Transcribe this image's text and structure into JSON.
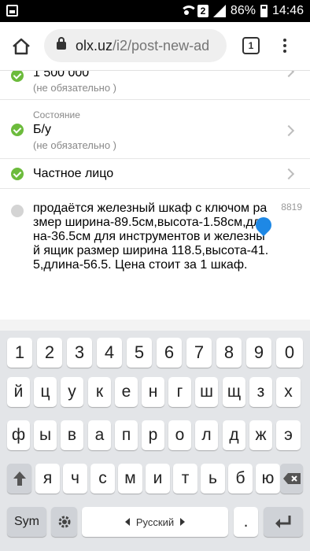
{
  "status_bar": {
    "battery": "86%",
    "time": "14:46",
    "sim": "2"
  },
  "browser": {
    "url_host": "olx.uz",
    "url_path": "/i2/post-new-ad",
    "tab_count": "1"
  },
  "form": {
    "price": {
      "value": "1 500 000",
      "hint": "(не обязательно )"
    },
    "condition": {
      "label": "Состояние",
      "value": "Б/у",
      "hint": "(не обязательно )"
    },
    "seller_type": {
      "value": "Частное лицо"
    },
    "description": {
      "text": "продаётся  железный шкаф с ключом размер ширина-89.5см,высота-1.58см,длина-36.5см для инструментов и железный ящик размер ширина 118.5,высота-41.5,длина-56.5. Цена стоит за 1 шкаф.",
      "char_counter": "8819"
    }
  },
  "keyboard": {
    "row_numbers": [
      "1",
      "2",
      "3",
      "4",
      "5",
      "6",
      "7",
      "8",
      "9",
      "0"
    ],
    "row1": [
      "й",
      "ц",
      "у",
      "к",
      "е",
      "н",
      "г",
      "ш",
      "щ",
      "з",
      "х"
    ],
    "row2": [
      "ф",
      "ы",
      "в",
      "а",
      "п",
      "р",
      "о",
      "л",
      "д",
      "ж",
      "э"
    ],
    "row3": [
      "я",
      "ч",
      "с",
      "м",
      "и",
      "т",
      "ь",
      "б",
      "ю"
    ],
    "sym_label": "Sym",
    "space_label": "Русский",
    "dot_label": "."
  },
  "colors": {
    "check_green": "#6cbb3c",
    "cursor_blue": "#1e88e5"
  }
}
